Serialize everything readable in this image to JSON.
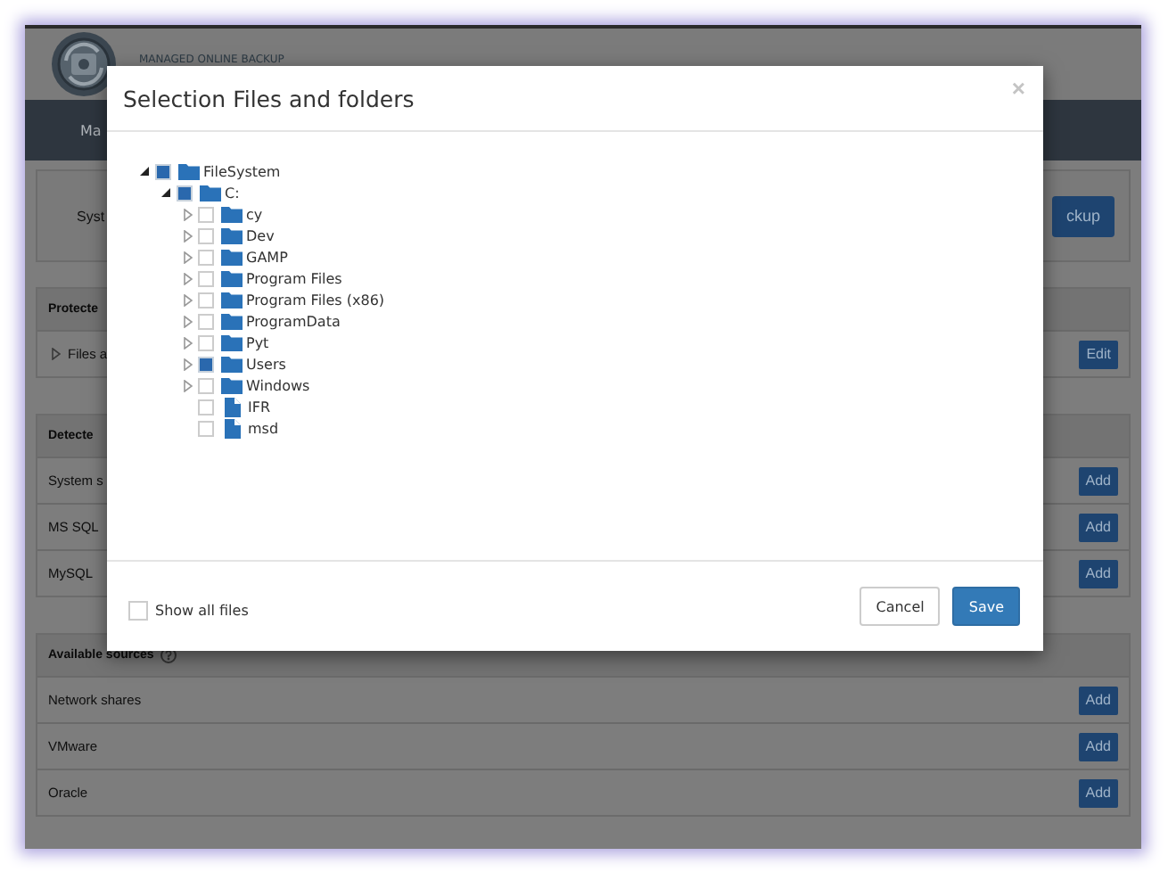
{
  "header": {
    "brand": "MANAGED ONLINE BACKUP"
  },
  "nav": {
    "items": [
      "Ma"
    ]
  },
  "top_box": {
    "label": "Syst",
    "button": "ckup"
  },
  "panels": [
    {
      "heading": "Protecte",
      "help": false,
      "rows": [
        {
          "label": "Files a",
          "expandable": true,
          "button": "Edit"
        }
      ]
    },
    {
      "heading": "Detecte",
      "help": false,
      "rows": [
        {
          "label": "System s",
          "expandable": false,
          "button": "Add"
        },
        {
          "label": "MS SQL",
          "expandable": false,
          "button": "Add"
        },
        {
          "label": "MySQL",
          "expandable": false,
          "button": "Add"
        }
      ]
    },
    {
      "heading": "Available sources",
      "help": true,
      "rows": [
        {
          "label": "Network shares",
          "expandable": false,
          "button": "Add"
        },
        {
          "label": "VMware",
          "expandable": false,
          "button": "Add"
        },
        {
          "label": "Oracle",
          "expandable": false,
          "button": "Add"
        }
      ]
    }
  ],
  "modal": {
    "title": "Selection Files and folders",
    "close": "×",
    "tree": [
      {
        "label": "FileSystem",
        "kind": "folder",
        "checked": true,
        "expanded": true,
        "children": [
          {
            "label": "C:",
            "kind": "folder",
            "checked": true,
            "expanded": true,
            "children": [
              {
                "label": "cy",
                "kind": "folder",
                "checked": false,
                "expanded": false
              },
              {
                "label": "Dev",
                "kind": "folder",
                "checked": false,
                "expanded": false
              },
              {
                "label": "GAMP",
                "kind": "folder",
                "checked": false,
                "expanded": false
              },
              {
                "label": "Program Files",
                "kind": "folder",
                "checked": false,
                "expanded": false
              },
              {
                "label": "Program Files (x86)",
                "kind": "folder",
                "checked": false,
                "expanded": false
              },
              {
                "label": "ProgramData",
                "kind": "folder",
                "checked": false,
                "expanded": false
              },
              {
                "label": "Pyt",
                "kind": "folder",
                "checked": false,
                "expanded": false
              },
              {
                "label": "Users",
                "kind": "folder",
                "checked": true,
                "expanded": false
              },
              {
                "label": "Windows",
                "kind": "folder",
                "checked": false,
                "expanded": false
              },
              {
                "label": "IFR",
                "kind": "file",
                "checked": false
              },
              {
                "label": "msd",
                "kind": "file",
                "checked": false
              }
            ]
          }
        ]
      }
    ],
    "show_all_files": {
      "label": "Show all files",
      "checked": false
    },
    "buttons": [
      {
        "label": "Cancel",
        "kind": "default"
      },
      {
        "label": "Save",
        "kind": "primary"
      }
    ]
  }
}
